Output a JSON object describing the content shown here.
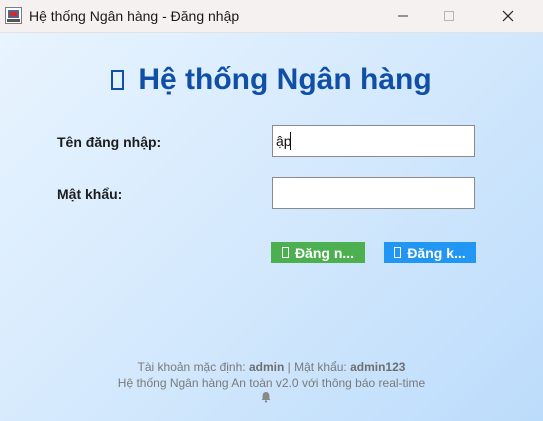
{
  "window": {
    "title": "Hệ thống Ngân hàng - Đăng nhập"
  },
  "header": {
    "heading": "Hệ thống Ngân hàng"
  },
  "form": {
    "username_label": "Tên đăng nhập:",
    "username_value": "ập",
    "password_label": "Mật khẩu:",
    "password_value": ""
  },
  "buttons": {
    "login_label": "Đăng n...",
    "register_label": "Đăng k..."
  },
  "footer": {
    "default_account_prefix": "Tài khoản mặc định: ",
    "default_username": "admin",
    "separator": " | Mật khẩu: ",
    "default_password": "admin123",
    "tagline": "Hệ thống Ngân hàng An toàn v2.0 với thông báo real-time"
  },
  "icons": {
    "app": "java-app-icon",
    "bell": "bell-icon"
  },
  "colors": {
    "heading": "#0f4fa6",
    "login_button": "#4caf50",
    "register_button": "#2196f3"
  }
}
